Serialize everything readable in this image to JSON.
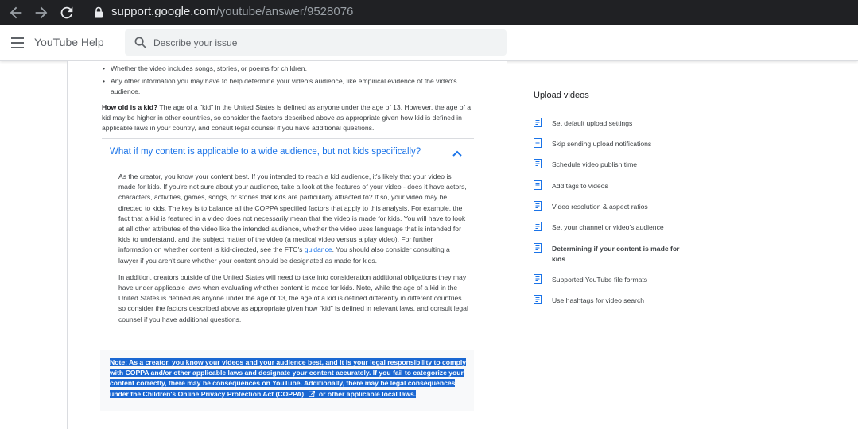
{
  "browser": {
    "url_host": "support.google.com",
    "url_path": "/youtube/answer/9528076"
  },
  "header": {
    "app_title": "YouTube Help",
    "search_placeholder": "Describe your issue"
  },
  "article": {
    "bullets": [
      "Whether the video includes songs, stories, or poems for children.",
      "Any other information you may have to help determine your video's audience, like empirical evidence of the video's audience."
    ],
    "kid_question": "How old is a kid?",
    "kid_answer": " The age of a \"kid\" in the United States is defined as anyone under the age of 13. However, the age of a kid may be higher in other countries, so consider the factors described above as appropriate given how kid is defined in applicable laws in your country, and consult legal counsel if you have additional questions.",
    "expander_title": "What if my content is applicable to a wide audience, but not kids specifically?",
    "expander_para1_a": "As the creator, you know your content best. If you intended to reach a kid audience, it's likely that your video is made for kids. If you're not sure about your audience, take a look at the features of your video - does it have actors, characters, activities, games, songs, or stories that kids are particularly attracted to? If so, your video may be directed to kids. The key is to balance all the COPPA specified factors that apply to this analysis. For example, the fact that a kid is featured in a video does not necessarily mean that the video is made for kids. You will have to look at all other attributes of the video like the intended audience, whether the video uses language that is intended for kids to understand, and the subject matter of the video (a medical video versus a play video). For further information on whether content is kid-directed, see the FTC's ",
    "expander_para1_link": "guidance",
    "expander_para1_b": ". You should also consider consulting a lawyer if you aren't sure whether your content should be designated as made for kids.",
    "expander_para2": "In addition, creators outside of the United States will need to take into consideration additional obligations they may have under applicable laws when evaluating whether content is made for kids. Note, while the age of a kid in the United States is defined as anyone under the age of 13, the age of a kid is defined differently in different countries so consider the factors described above as appropriate given how \"kid\" is defined in relevant laws, and consult legal counsel if you have additional questions.",
    "note_a": "Note: As a creator, you know your videos and your audience best, and it is your legal responsibility to comply with COPPA and/or other applicable laws and designate your content accurately. If you fail to  categorize your content correctly, there may be consequences on YouTube. Additionally, there may be legal consequences under the Children's Online Privacy Protection Act (COPPA)",
    "note_b": " or other applicable local laws."
  },
  "sidebar": {
    "title": "Upload videos",
    "items": [
      {
        "label": "Set default upload settings"
      },
      {
        "label": "Skip sending upload notifications"
      },
      {
        "label": "Schedule video publish time"
      },
      {
        "label": "Add tags to videos"
      },
      {
        "label": "Video resolution & aspect ratios"
      },
      {
        "label": "Set your channel or video's audience"
      },
      {
        "label": "Determining if your content is made for kids",
        "active": true
      },
      {
        "label": "Supported YouTube file formats"
      },
      {
        "label": "Use hashtags for video search"
      }
    ]
  },
  "colors": {
    "link": "#1a73e8",
    "selection": "#1a67d2",
    "chrome": "#202124"
  }
}
